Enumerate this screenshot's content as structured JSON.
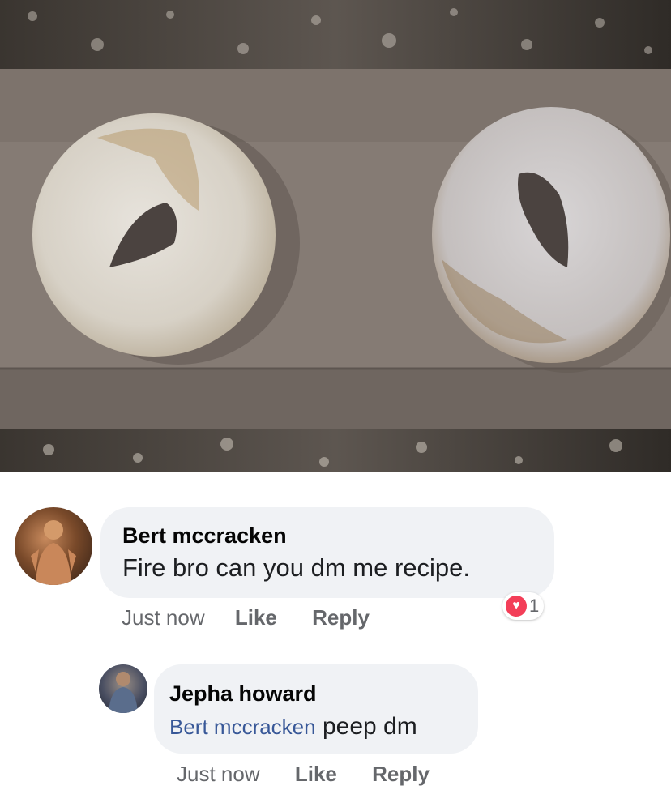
{
  "comments": [
    {
      "author": "Bert mccracken",
      "text": "Fire bro can you dm me recipe.",
      "meta": {
        "time": "Just now",
        "like": "Like",
        "reply": "Reply"
      },
      "reaction": {
        "icon": "heart-icon",
        "count": "1"
      }
    },
    {
      "author": "Jepha howard",
      "mention": "Bert mccracken",
      "text": " peep dm",
      "meta": {
        "time": "Just now",
        "like": "Like",
        "reply": "Reply"
      }
    }
  ],
  "colors": {
    "bubble": "#f0f2f5",
    "mention": "#385898",
    "reaction": "#f33e58",
    "meta": "#65676b"
  }
}
